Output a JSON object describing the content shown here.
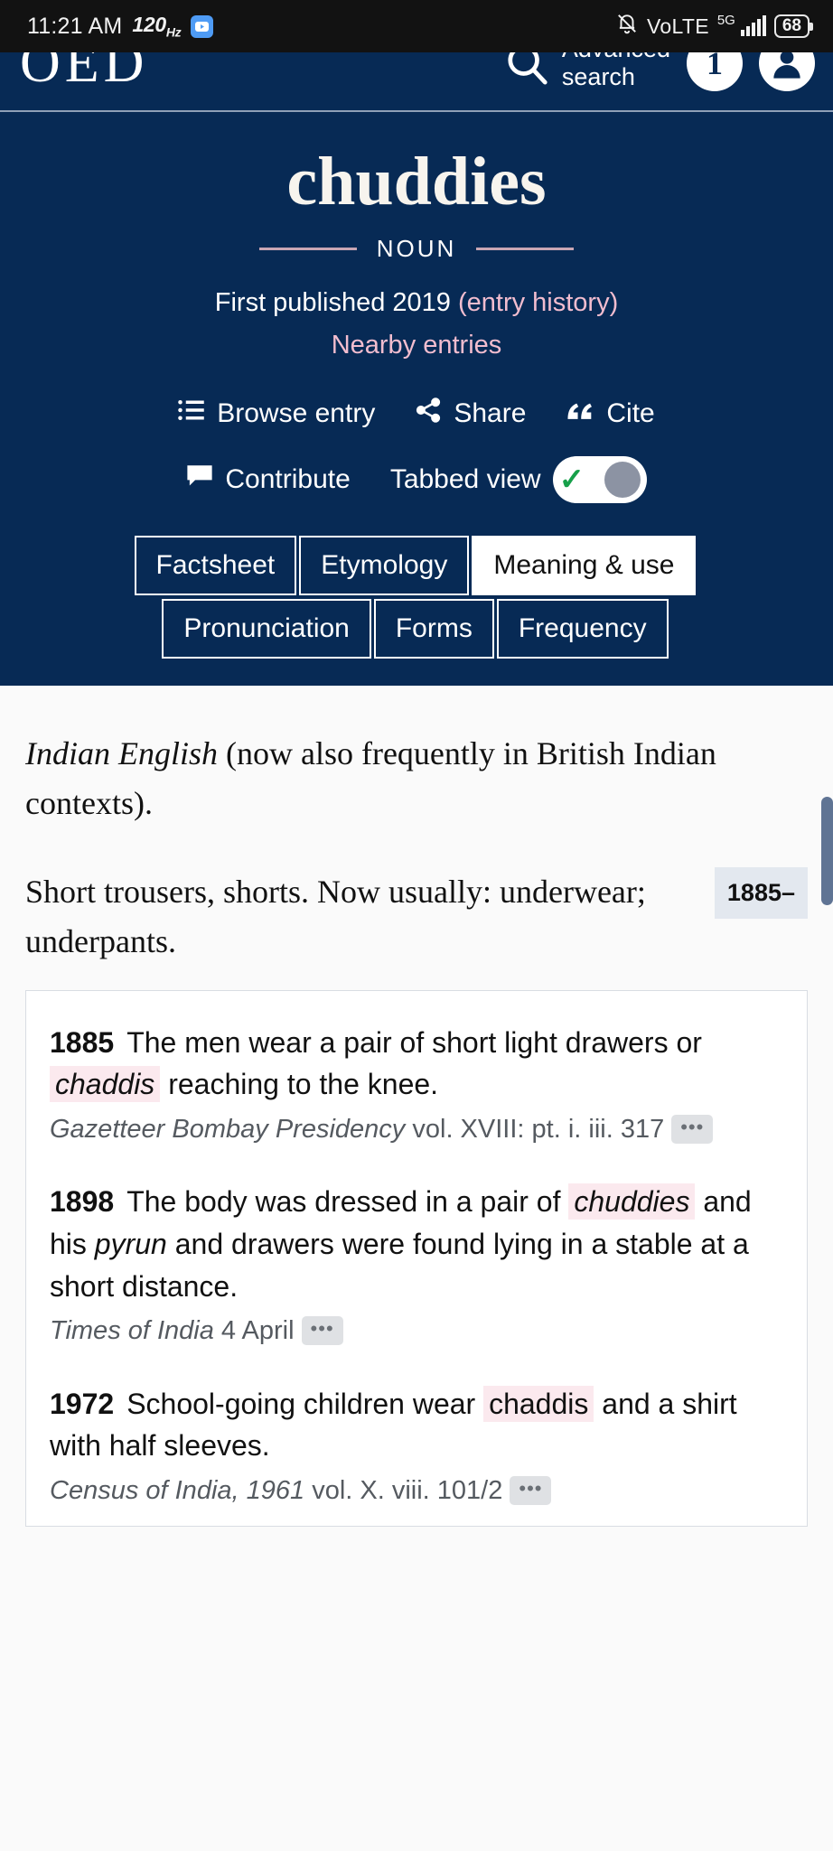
{
  "statusbar": {
    "time": "11:21 AM",
    "refresh_rate": "120",
    "refresh_unit": "Hz",
    "app_badge_icon": "youtube-icon",
    "mute_icon": "bell-muted-icon",
    "volte": "VoLTE",
    "network": "5G",
    "battery": "68"
  },
  "header": {
    "logo": "OED",
    "search_icon": "search-icon",
    "advanced_search_line1": "Advanced",
    "advanced_search_line2": "search",
    "notification_count": "1",
    "account_icon": "account-avatar-icon"
  },
  "entry": {
    "headword": "chuddies",
    "part_of_speech": "NOUN",
    "published_prefix": "First published 2019",
    "entry_history_link": "(entry history)",
    "nearby_entries_link": "Nearby entries"
  },
  "actions": {
    "browse_entry": "Browse entry",
    "browse_icon": "list-icon",
    "share": "Share",
    "share_icon": "share-icon",
    "cite": "Cite",
    "cite_icon": "quote-icon",
    "contribute": "Contribute",
    "contribute_icon": "comment-icon",
    "tabbed_view": "Tabbed view",
    "toggle_state": "on",
    "toggle_check": "✓"
  },
  "tabs": {
    "row1": [
      {
        "label": "Factsheet",
        "active": false
      },
      {
        "label": "Etymology",
        "active": false
      },
      {
        "label": "Meaning & use",
        "active": true
      }
    ],
    "row2": [
      {
        "label": "Pronunciation",
        "active": false
      },
      {
        "label": "Forms",
        "active": false
      },
      {
        "label": "Frequency",
        "active": false
      }
    ]
  },
  "main": {
    "region_label": "Indian English",
    "region_rest": " (now also frequently in British Indian contexts).",
    "date_badge": "1885–",
    "definition": "Short trousers, shorts. Now usually: underwear; underpants.",
    "definition_part1": "Short trousers, shorts. Now usually:",
    "definition_part2": "underwear; underpants."
  },
  "quotations": [
    {
      "year": "1885",
      "text_before": "The men wear a pair of short light drawers or ",
      "highlight": "chaddis",
      "highlight_italic": true,
      "text_after": " reaching to the knee.",
      "source_title": "Gazetteer Bombay Presidency",
      "source_rest": " vol. XVIII: pt. i. iii. 317",
      "more_label": "•••"
    },
    {
      "year": "1898",
      "text_before": "The body was dressed in a pair of ",
      "highlight": "chuddies",
      "highlight_italic": true,
      "text_mid": " and his ",
      "italic_word": "pyrun",
      "text_after": " and drawers were found lying in a stable at a short distance.",
      "source_title": "Times of India",
      "source_rest": " 4 April",
      "more_label": "•••"
    },
    {
      "year": "1972",
      "text_before": "School-going children wear ",
      "highlight": "chaddis",
      "highlight_italic": false,
      "text_after": " and a shirt with half sleeves.",
      "source_title": "Census of India, 1961",
      "source_rest": " vol. X. viii. 101/2",
      "more_label": "•••"
    }
  ],
  "colors": {
    "brand_navy": "#072a55",
    "link_pink": "#f2bdcf",
    "highlight_pink": "#fbe9ee",
    "badge_grey_blue": "#e3e8ef",
    "toggle_check_green": "#17a04a"
  }
}
